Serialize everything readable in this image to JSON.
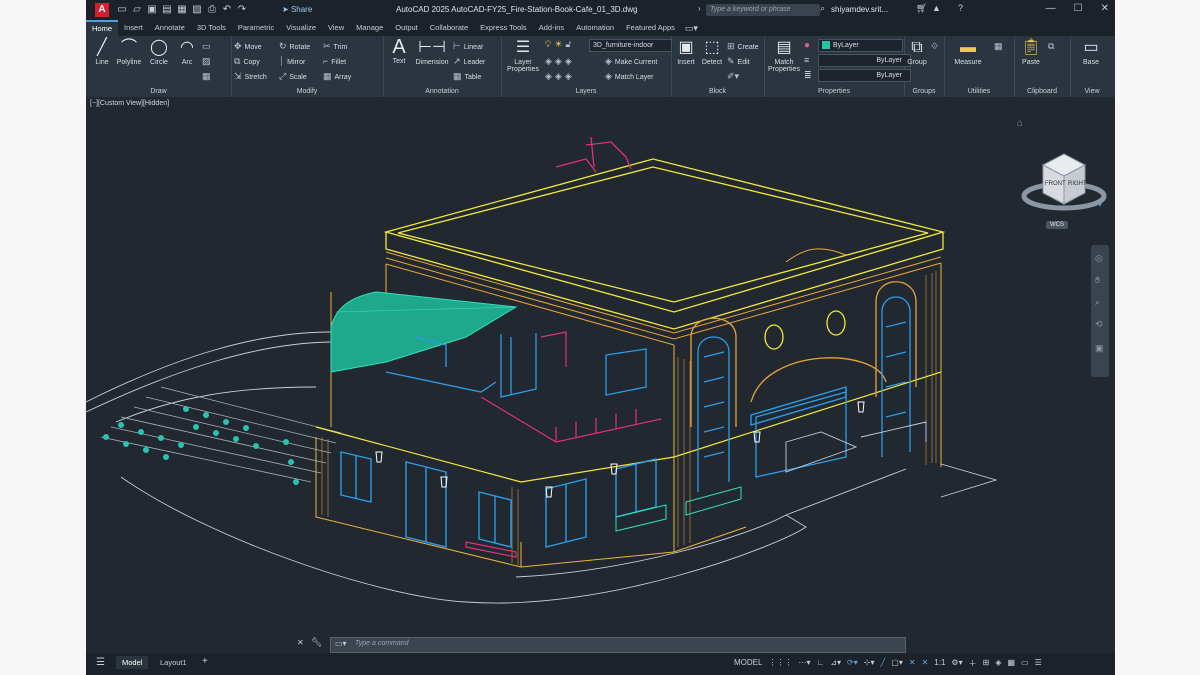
{
  "app": {
    "logo": "A",
    "title": "AutoCAD 2025    AutoCAD-FY25_Fire-Station-Book-Cafe_01_3D.dwg",
    "share": "Share",
    "search_placeholder": "Type a keyword or phrase",
    "user": "shiyamdev.srit..."
  },
  "tabs": [
    "Home",
    "Insert",
    "Annotate",
    "3D Tools",
    "Parametric",
    "Visualize",
    "View",
    "Manage",
    "Output",
    "Collaborate",
    "Express Tools",
    "Add-ins",
    "Automation",
    "Featured Apps"
  ],
  "ribbon": {
    "draw": {
      "label": "Draw",
      "line": "Line",
      "polyline": "Polyline",
      "circle": "Circle",
      "arc": "Arc"
    },
    "modify": {
      "label": "Modify",
      "move": "Move",
      "rotate": "Rotate",
      "trim": "Trim",
      "copy": "Copy",
      "mirror": "Mirror",
      "fillet": "Fillet",
      "stretch": "Stretch",
      "scale": "Scale",
      "array": "Array"
    },
    "annotation": {
      "label": "Annotation",
      "text": "Text",
      "dimension": "Dimension",
      "linear": "Linear",
      "leader": "Leader",
      "table": "Table"
    },
    "layers": {
      "label": "Layers",
      "layer_properties": "Layer Properties",
      "current_layer": "3D_furniture-indoor",
      "make_current": "Make Current",
      "match_layer": "Match Layer"
    },
    "block": {
      "label": "Block",
      "insert": "Insert",
      "detect": "Detect",
      "create": "Create",
      "edit": "Edit"
    },
    "properties": {
      "label": "Properties",
      "match_properties": "Match Properties",
      "bylayer_color": "ByLayer",
      "bylayer_line": "ByLayer",
      "bylayer_weight": "ByLayer"
    },
    "groups": {
      "label": "Groups",
      "group": "Group"
    },
    "utilities": {
      "label": "Utilities",
      "measure": "Measure"
    },
    "clipboard": {
      "label": "Clipboard",
      "paste": "Paste"
    },
    "view": {
      "label": "View",
      "base": "Base"
    }
  },
  "viewport": {
    "label": "[−][Custom View][Hidden]",
    "cube_front": "FRONT",
    "cube_right": "RIGHT",
    "wcs": "WCS"
  },
  "command": {
    "placeholder": "Type a command"
  },
  "status": {
    "model_tab": "Model",
    "layout_tab": "Layout1",
    "model_label": "MODEL",
    "scale": "1:1"
  }
}
